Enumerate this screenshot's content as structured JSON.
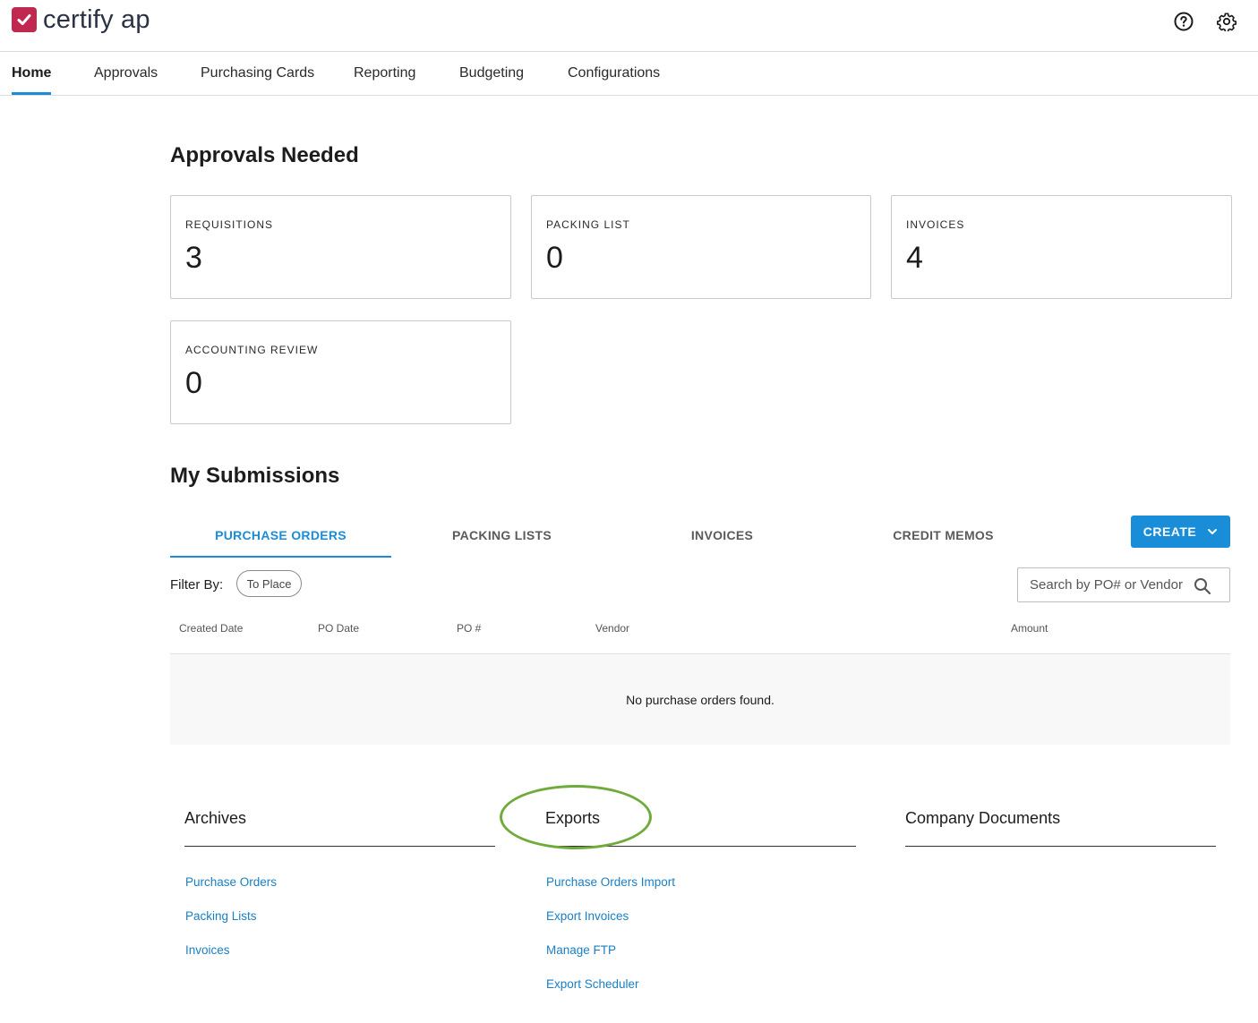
{
  "app": {
    "logo_text": "certify ap"
  },
  "header": {
    "help_icon": "question-circle-icon",
    "settings_icon": "gear-icon"
  },
  "nav": {
    "items": [
      {
        "label": "Home",
        "active": true
      },
      {
        "label": "Approvals"
      },
      {
        "label": "Purchasing Cards"
      },
      {
        "label": "Reporting"
      },
      {
        "label": "Budgeting"
      },
      {
        "label": "Configurations"
      }
    ]
  },
  "approvals": {
    "title": "Approvals Needed",
    "cards": [
      {
        "label": "REQUISITIONS",
        "count": "3"
      },
      {
        "label": "PACKING LIST",
        "count": "0"
      },
      {
        "label": "INVOICES",
        "count": "4"
      },
      {
        "label": "ACCOUNTING REVIEW",
        "count": "0"
      }
    ]
  },
  "submissions": {
    "title": "My Submissions",
    "tabs": [
      {
        "label": "PURCHASE ORDERS",
        "active": true
      },
      {
        "label": "PACKING LISTS"
      },
      {
        "label": "INVOICES"
      },
      {
        "label": "CREDIT MEMOS"
      }
    ],
    "create_label": "CREATE",
    "filter_label": "Filter By:",
    "filter_chip": "To Place",
    "search_placeholder": "Search by PO# or Vendor",
    "columns": [
      "Created Date",
      "PO Date",
      "PO #",
      "Vendor",
      "Amount"
    ],
    "empty_message": "No purchase orders found."
  },
  "bottom": {
    "archives": {
      "title": "Archives",
      "links": [
        "Purchase Orders",
        "Packing Lists",
        "Invoices"
      ]
    },
    "exports": {
      "title": "Exports",
      "links": [
        "Purchase Orders Import",
        "Export Invoices",
        "Manage FTP",
        "Export Scheduler"
      ]
    },
    "documents": {
      "title": "Company Documents",
      "links": []
    }
  },
  "colors": {
    "brand": "#c0284f",
    "accent": "#1a8dd8",
    "link": "#1a7fc2",
    "highlight": "#6faa3a"
  }
}
